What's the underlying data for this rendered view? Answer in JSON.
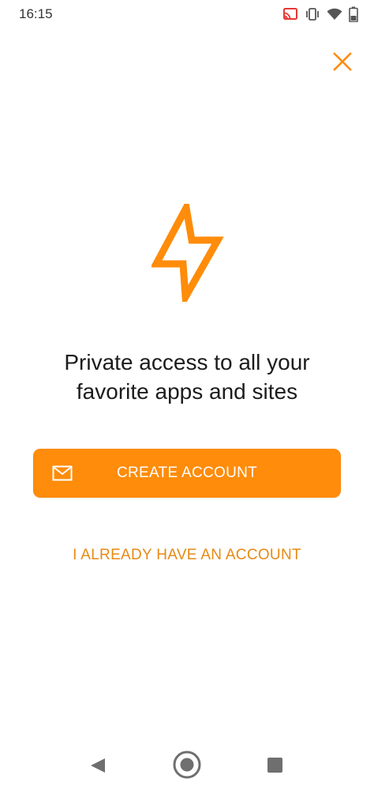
{
  "status_bar": {
    "time": "16:15",
    "icons": [
      "cast-icon",
      "vibrate-icon",
      "wifi-icon",
      "battery-icon"
    ]
  },
  "header": {
    "close_icon": "close-icon"
  },
  "brand": {
    "logo_icon": "lightning-bolt-icon",
    "accent_color": "#ff8c0a"
  },
  "main": {
    "headline_line1": "Private access to all your",
    "headline_line2": "favorite apps and sites",
    "create_account_label": "CREATE ACCOUNT",
    "create_account_icon": "mail-icon",
    "sign_in_label": "I ALREADY HAVE AN ACCOUNT"
  },
  "nav_bar": {
    "icons": [
      "back-icon",
      "home-icon",
      "recents-icon"
    ]
  }
}
